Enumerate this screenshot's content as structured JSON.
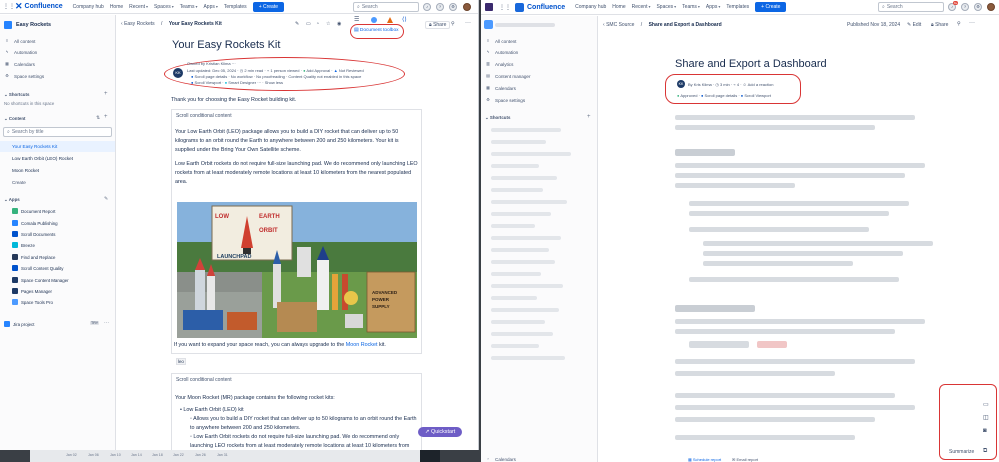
{
  "left": {
    "topbar": {
      "app_name": "Confluence",
      "nav": [
        "Company hub",
        "Home",
        "Recent",
        "Spaces",
        "Teams",
        "Apps",
        "Templates"
      ],
      "create_label": "Create",
      "search_placeholder": "Search"
    },
    "sidebar": {
      "space_name": "Easy Rockets",
      "top_items": [
        "All content",
        "Automation",
        "Calendars",
        "Space settings"
      ],
      "shortcuts_header": "Shortcuts",
      "shortcuts_empty": "No shortcuts in this space",
      "content_header": "Content",
      "filter_placeholder": "Search by title",
      "tree": [
        "Your Easy Rockets Kit",
        "Low Earth Orbit (LEO) Rocket",
        "Moon Rocket"
      ],
      "create_label": "Create",
      "apps_header": "Apps",
      "apps": [
        "Document Report",
        "Comala Publishing",
        "Scroll Documents",
        "Breeze",
        "Find and Replace",
        "Scroll Content Quality",
        "Space Content Manager",
        "Pages Manager",
        "Space Tools Pro"
      ],
      "jira_label": "Jira project",
      "jira_badge": "TRY"
    },
    "page": {
      "breadcrumb_space": "Easy Rockets",
      "breadcrumb_page": "Your Easy Rockets Kit",
      "title": "Your Easy Rockets Kit",
      "doc_toolbox": "Document toolbox",
      "share_label": "Share",
      "owner": "Owned by Kristian Klima",
      "meta_line1": [
        "Last updated: Dec 05, 2024",
        "2 min read",
        "1 person viewed",
        "Add Approval",
        "Not Reviewed"
      ],
      "meta_line2": [
        "Scroll page details",
        "No workflow",
        "No proofreading",
        "Content Quality not enabled in this space"
      ],
      "meta_line3": [
        "Scroll Viewport",
        "Smart Designer",
        "Show less"
      ],
      "intro": "Thank you for choosing the Easy Rocket building kit.",
      "card1_header": "Scroll conditional content",
      "card1_p1": "Your Low Earth Orbit (LEO) package allows you to build a DIY rocket that can deliver up to 50 kilograms to an orbit round the Earth to anywhere between 200 and 250 kilometers. Your kit is supplied under the Bring Your Own Satellite scheme.",
      "card1_p2": "Low Earth Orbit rockets do not require full-size launching pad. We do recommend only launching LEO rockets from at least moderately remote locations at least 10 kilometers from the nearest populated area.",
      "image_sign": "LOW EARTH ORBIT LAUNCHPAD",
      "image_crate": "ADVANCED POWER SUPPLY",
      "card1_p3_pre": "If you want to expand your space reach, you can always upgrade to the ",
      "card1_p3_link": "Moon Rocket",
      "card1_p3_post": " kit.",
      "leo_tag": "leo",
      "card2_header": "Scroll conditional content",
      "card2_p1": "Your Moon Rocket (MR) package contains the following rocket kits:",
      "card2_b1": "Low Earth Orbit (LEO) kit",
      "card2_b1a": "Allows you to build a DIY rocket that can deliver up to 50 kilograms to an orbit round the Earth to anywhere between 200 and 250 kilometers.",
      "card2_b1b": "Low Earth Orbit rockets do not require full-size launching pad. We do recommend only launching LEO rockets from at least moderately remote locations at least 10 kilometers from the nearest populated area.",
      "quickstart": "Quickstart",
      "axis_ticks": [
        "Jan 02",
        "Jan 06",
        "Jan 10",
        "Jan 14",
        "Jan 18",
        "Jan 22",
        "Jan 26",
        "Jan 31"
      ]
    }
  },
  "right": {
    "topbar": {
      "app_name": "Confluence",
      "nav": [
        "Company hub",
        "Home",
        "Recent",
        "Spaces",
        "Teams",
        "Apps",
        "Templates"
      ],
      "create_label": "Create",
      "search_placeholder": "Search",
      "notif_count": "9+"
    },
    "sidebar": {
      "items": [
        "All content",
        "Automation",
        "Analytics",
        "Content manager",
        "Calendars",
        "Space settings"
      ],
      "shortcuts_header": "Shortcuts",
      "bottom_label": "Calendars"
    },
    "page": {
      "breadcrumb_space": "SMC Source",
      "breadcrumb_page": "Share and Export a Dashboard",
      "published": "Published Nov 18, 2024",
      "edit_label": "Edit",
      "share_label": "Share",
      "title": "Share and Export a Dashboard",
      "byline": [
        "By Kris Klima",
        "3 min",
        "4",
        "Add a reaction"
      ],
      "meta2": [
        "Approved",
        "Scroll page details",
        "Scroll Viewport"
      ],
      "summarize": "Summarize",
      "bottom_links": [
        "Schedule report",
        "Email report"
      ]
    }
  },
  "colors": {
    "brand": "#0052cc",
    "create": "#0c66e4",
    "annotation": "#d93535",
    "quickstart": "#6e5dc6"
  }
}
